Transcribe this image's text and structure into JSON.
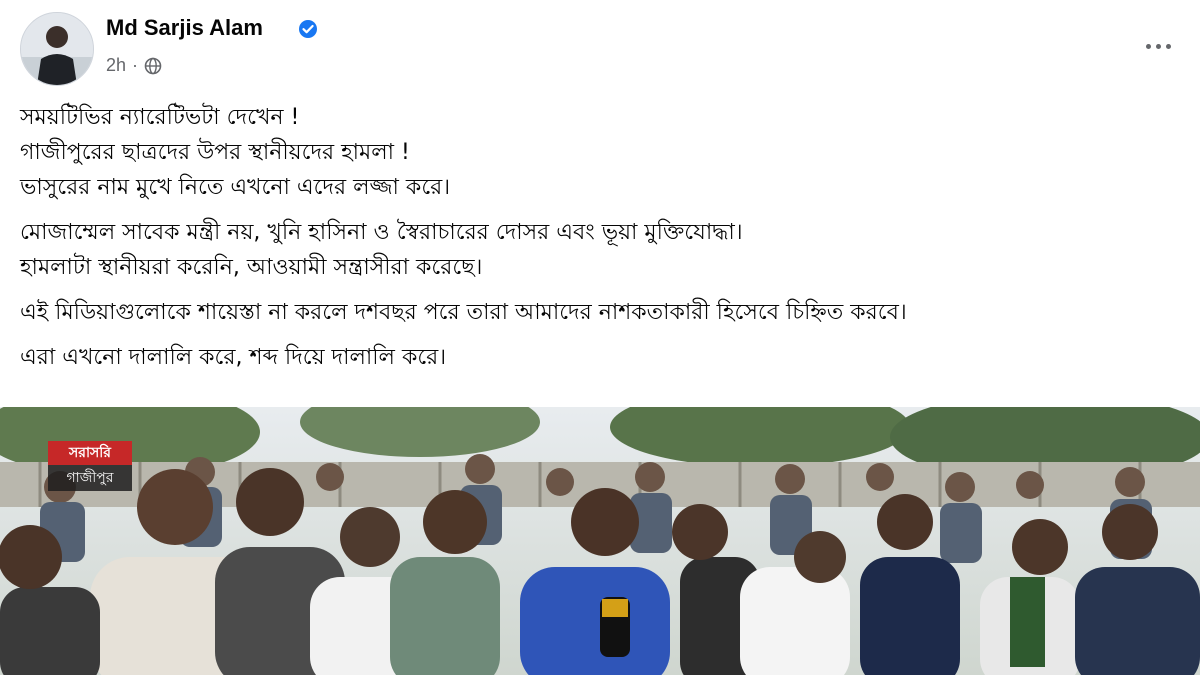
{
  "post": {
    "author": "Md Sarjis Alam",
    "time": "2h",
    "dot": "·",
    "paragraphs": [
      [
        "সময়টিভির ন্যারেটিভটা দেখেন !",
        "গাজীপুরের ছাত্রদের উপর স্থানীয়দের হামলা !",
        "ভাসুরের নাম মুখে নিতে এখনো এদের লজ্জা করে।"
      ],
      [
        "মোজাম্মেল সাবেক মন্ত্রী নয়, খুনি হাসিনা ও স্বৈরাচারের দোসর এবং ভূয়া মুক্তিযোদ্ধা।",
        "হামলাটা স্থানীয়রা করেনি, আওয়ামী সন্ত্রাসীরা করেছে।"
      ],
      [
        "এই মিডিয়াগুলোকে শায়েস্তা না করলে দশবছর পরে তারা আমাদের নাশকতাকারী হিসেবে চিহ্নিত করবে।"
      ],
      [
        "এরা এখনো দালালি করে, শব্দ দিয়ে দালালি করে।"
      ]
    ]
  },
  "photo": {
    "logo_top": "সরাসরি",
    "logo_bottom": "গাজীপুর"
  },
  "icons": {
    "verified": "verified-badge-icon",
    "privacy": "globe-icon",
    "more": "more-options-icon"
  },
  "colors": {
    "verified": "#1877f2",
    "meta_text": "#65676b",
    "live_red": "#c62828"
  }
}
